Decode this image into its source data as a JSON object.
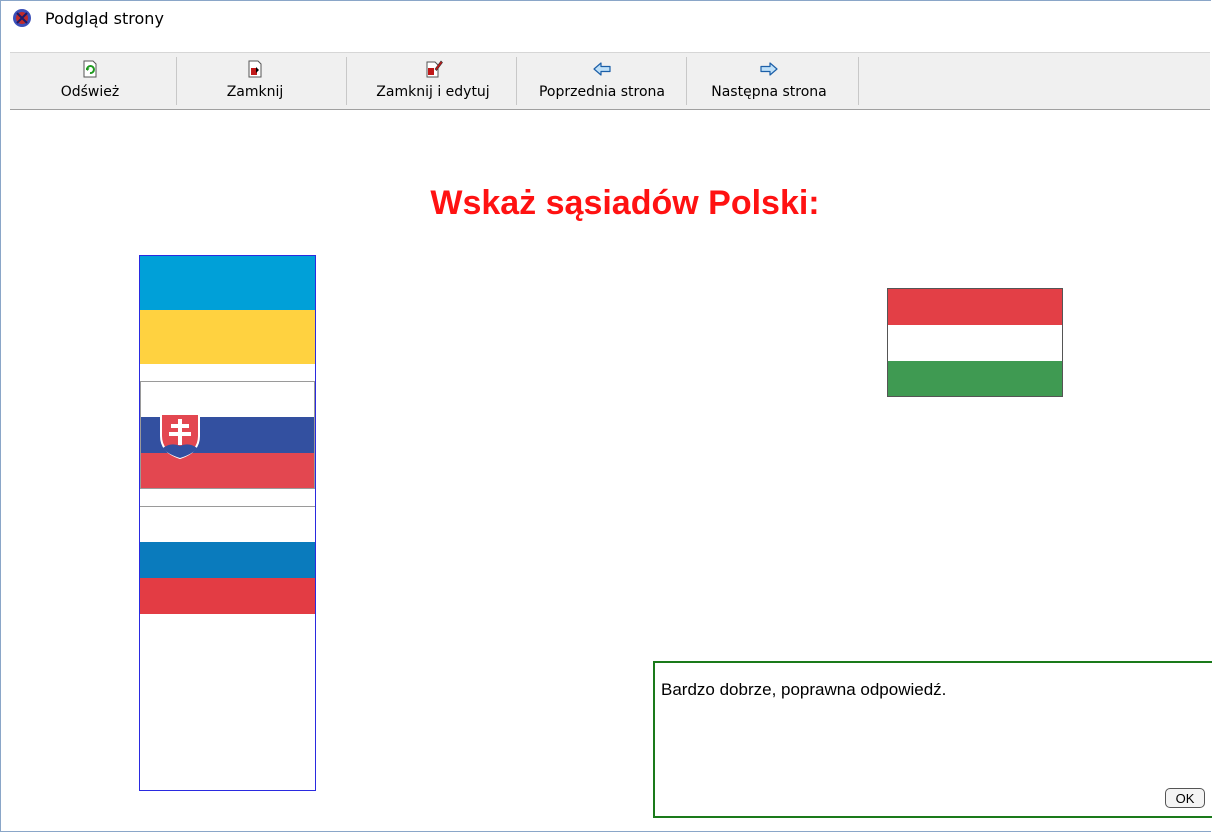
{
  "window": {
    "title": "Podgląd strony"
  },
  "toolbar": {
    "items": [
      {
        "label": "Odśwież",
        "icon": "refresh-icon"
      },
      {
        "label": "Zamknij",
        "icon": "close-document-icon"
      },
      {
        "label": "Zamknij i edytuj",
        "icon": "close-edit-icon"
      },
      {
        "label": "Poprzednia strona",
        "icon": "arrow-left-icon"
      },
      {
        "label": "Następna strona",
        "icon": "arrow-right-icon"
      }
    ]
  },
  "content": {
    "heading": "Wskaż sąsiadów Polski:",
    "heading_color": "#ff1212",
    "placed_flags": [
      "ukraine-flag",
      "slovakia-flag",
      "slovenia-flag"
    ],
    "unplaced_flags": [
      "hungary-flag"
    ]
  },
  "feedback": {
    "message": "Bardzo dobrze, poprawna odpowiedź.",
    "ok_label": "OK",
    "border_color": "#1a7a1a"
  }
}
